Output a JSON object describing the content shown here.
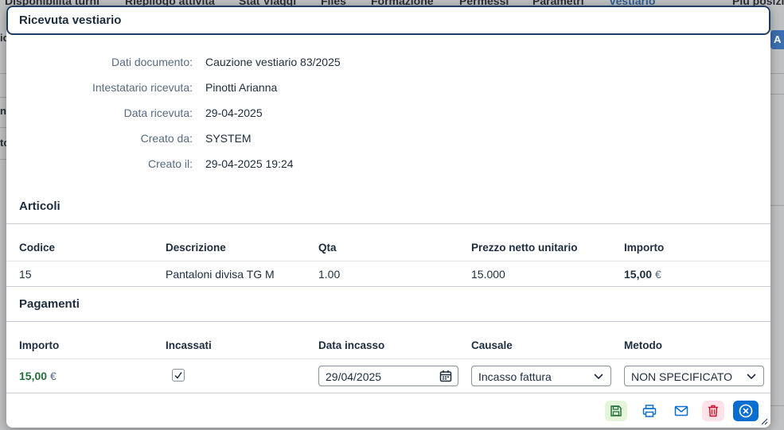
{
  "background": {
    "tabs": [
      "Disponibilità turni",
      "Riepilogo attività",
      "Stat Viaggi",
      "Files",
      "Formazione",
      "Permessi",
      "Parametri",
      "Vestiario",
      "Più posizioni"
    ],
    "active_tab": "Vestiario",
    "right_button_label": "A",
    "left_fragments": [
      "ic",
      "ni",
      "to"
    ]
  },
  "dialog": {
    "title": "Ricevuta vestiario",
    "details": [
      {
        "label": "Dati documento:",
        "value": "Cauzione vestiario 83/2025"
      },
      {
        "label": "Intestatario ricevuta:",
        "value": "Pinotti Arianna"
      },
      {
        "label": "Data ricevuta:",
        "value": "29-04-2025"
      },
      {
        "label": "Creato da:",
        "value": "SYSTEM"
      },
      {
        "label": "Creato il:",
        "value": "29-04-2025 19:24"
      }
    ],
    "articles": {
      "title": "Articoli",
      "columns": [
        "Codice",
        "Descrizione",
        "Qta",
        "Prezzo netto unitario",
        "Importo"
      ],
      "rows": [
        {
          "codice": "15",
          "descrizione": "Pantaloni divisa TG M",
          "qta": "1.00",
          "prezzo": "15.000",
          "importo": "15,00",
          "currency": "€"
        }
      ]
    },
    "payments": {
      "title": "Pagamenti",
      "columns": [
        "Importo",
        "Incassati",
        "Data incasso",
        "Causale",
        "Metodo"
      ],
      "rows": [
        {
          "importo": "15,00",
          "currency": "€",
          "incassato": true,
          "data_incasso": "29/04/2025",
          "causale": "Incasso fattura",
          "metodo": "NON SPECIFICATO"
        }
      ]
    },
    "footer_buttons": [
      {
        "name": "save",
        "icon": "save-icon",
        "bg": "#e5f5d9",
        "color": "#256f3a"
      },
      {
        "name": "print",
        "icon": "print-icon",
        "bg": "transparent",
        "color": "#0a6ed1"
      },
      {
        "name": "email",
        "icon": "mail-icon",
        "bg": "transparent",
        "color": "#0a6ed1"
      },
      {
        "name": "delete",
        "icon": "trash-icon",
        "bg": "#fde2e7",
        "color": "#d0152b"
      },
      {
        "name": "close",
        "icon": "close-circle-icon",
        "bg": "#0a6ed1",
        "color": "#ffffff"
      }
    ]
  }
}
